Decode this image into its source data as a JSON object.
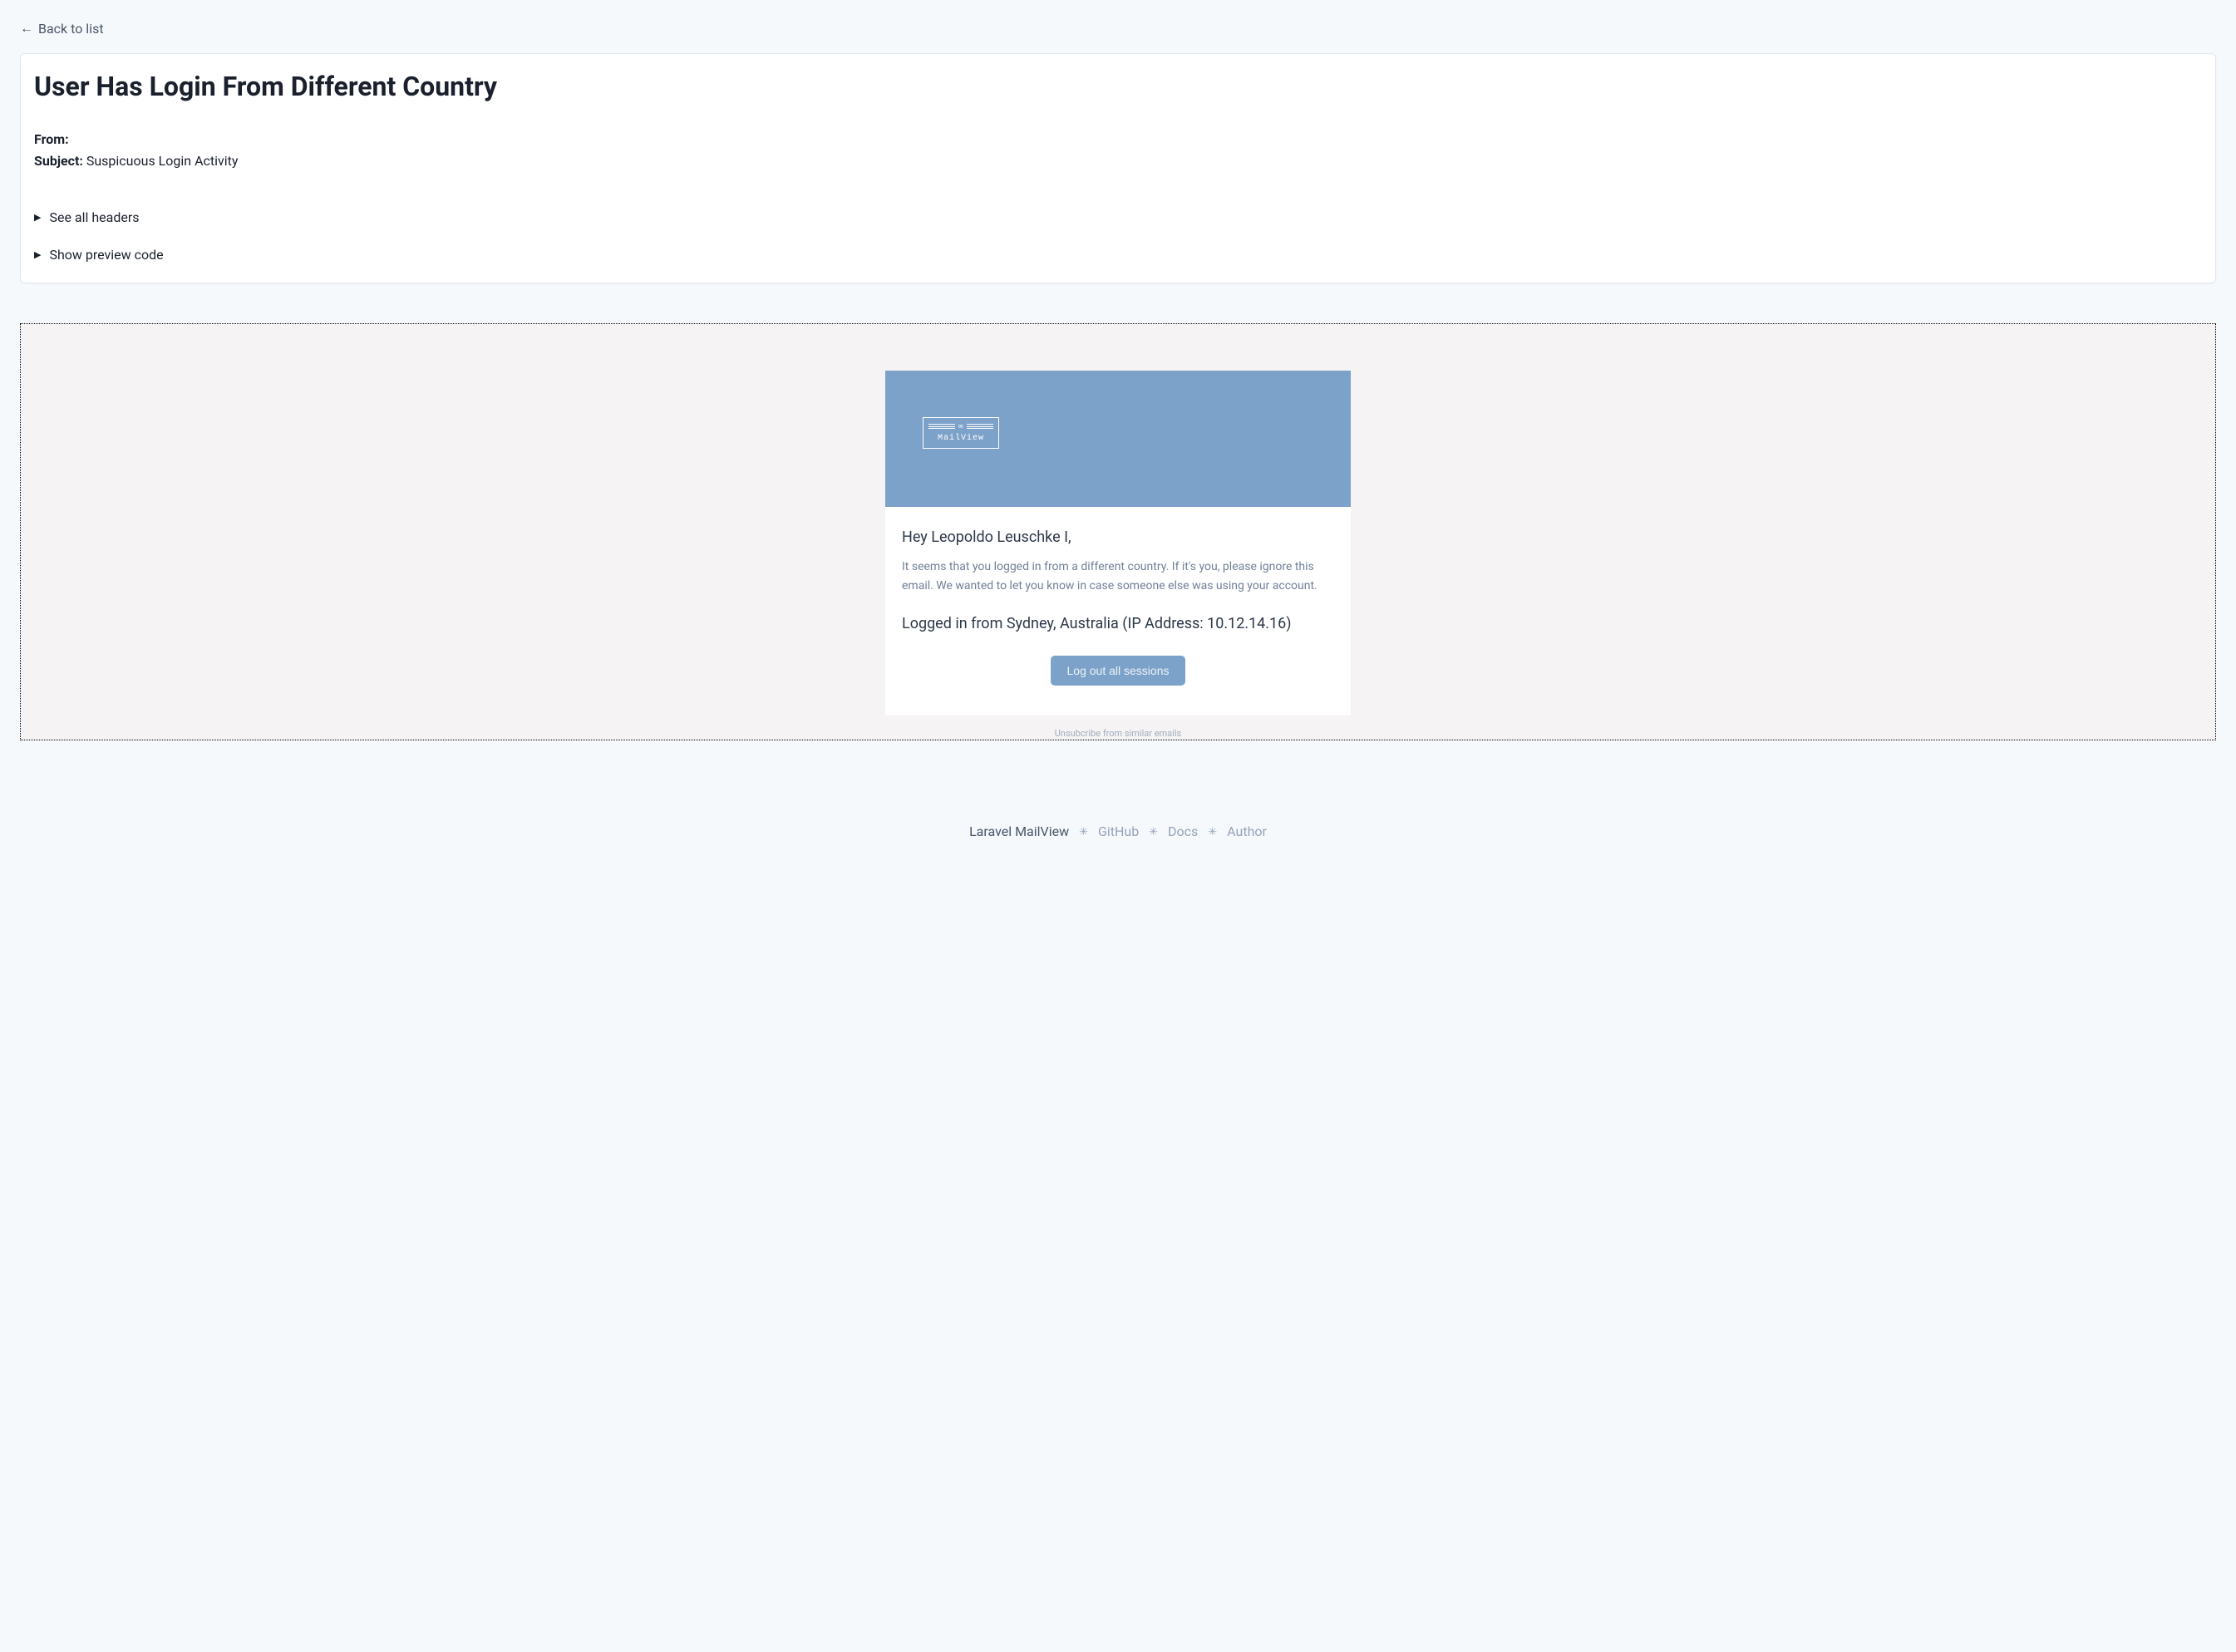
{
  "nav": {
    "back_label": "Back to list"
  },
  "card": {
    "title": "User Has Login From Different Country",
    "from_label": "From:",
    "from_value": "",
    "subject_label": "Subject:",
    "subject_value": "Suspicuous Login Activity",
    "details_headers": "See all headers",
    "details_code": "Show preview code"
  },
  "email": {
    "logo_text": "MailView",
    "greeting": "Hey Leopoldo Leuschke I,",
    "description": "It seems that you logged in from a different country. If it's you, please ignore this email. We wanted to let you know in case someone else was using your account.",
    "login_info": "Logged in from Sydney, Australia (IP Address: 10.12.14.16)",
    "cta_label": "Log out all sessions",
    "unsubscribe_label": "Unsubcribe from similar emails"
  },
  "footer": {
    "brand": "Laravel MailView",
    "links": [
      "GitHub",
      "Docs",
      "Author"
    ]
  },
  "colors": {
    "page_bg": "#f6f9fc",
    "card_border": "#e2e8f0",
    "email_accent": "#7da2c9",
    "preview_bg": "#f5f3f3",
    "text_dark": "#1a202c",
    "text_muted": "#718096"
  }
}
